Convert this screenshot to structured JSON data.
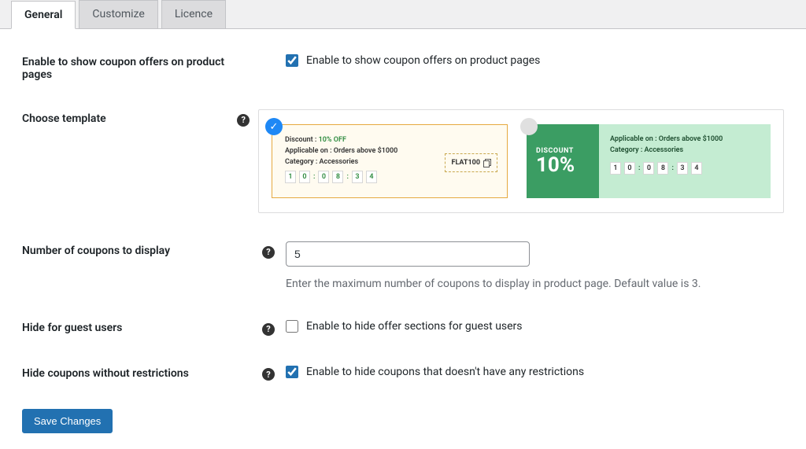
{
  "tabs": {
    "general": "General",
    "customize": "Customize",
    "licence": "Licence"
  },
  "fields": {
    "enable_offers": {
      "label": "Enable to show coupon offers on product pages",
      "checkbox_label": "Enable to show coupon offers on product pages"
    },
    "choose_template": {
      "label": "Choose template"
    },
    "num_coupons": {
      "label": "Number of coupons to display",
      "value": "5",
      "description": "Enter the maximum number of coupons to display in product page. Default value is 3."
    },
    "hide_guest": {
      "label": "Hide for guest users",
      "checkbox_label": "Enable to hide offer sections for guest users"
    },
    "hide_no_restrict": {
      "label": "Hide coupons without restrictions",
      "checkbox_label": "Enable to hide coupons that doesn't have any restrictions"
    }
  },
  "template1": {
    "discount_prefix": "Discount : ",
    "discount_value": "10% OFF",
    "applicable": "Applicable on : Orders above $1000",
    "category": "Category : Accessories",
    "code": "FLAT100",
    "timer": [
      "1",
      "0",
      "0",
      "8",
      "3",
      "4"
    ]
  },
  "template2": {
    "disc_label": "DISCOUNT",
    "disc_value": "10%",
    "applicable": "Applicable on : Orders above $1000",
    "category": "Category : Accessories",
    "timer": [
      "1",
      "0",
      "0",
      "8",
      "3",
      "4"
    ]
  },
  "help_glyph": "?",
  "check_glyph": "✓",
  "save_label": "Save Changes"
}
